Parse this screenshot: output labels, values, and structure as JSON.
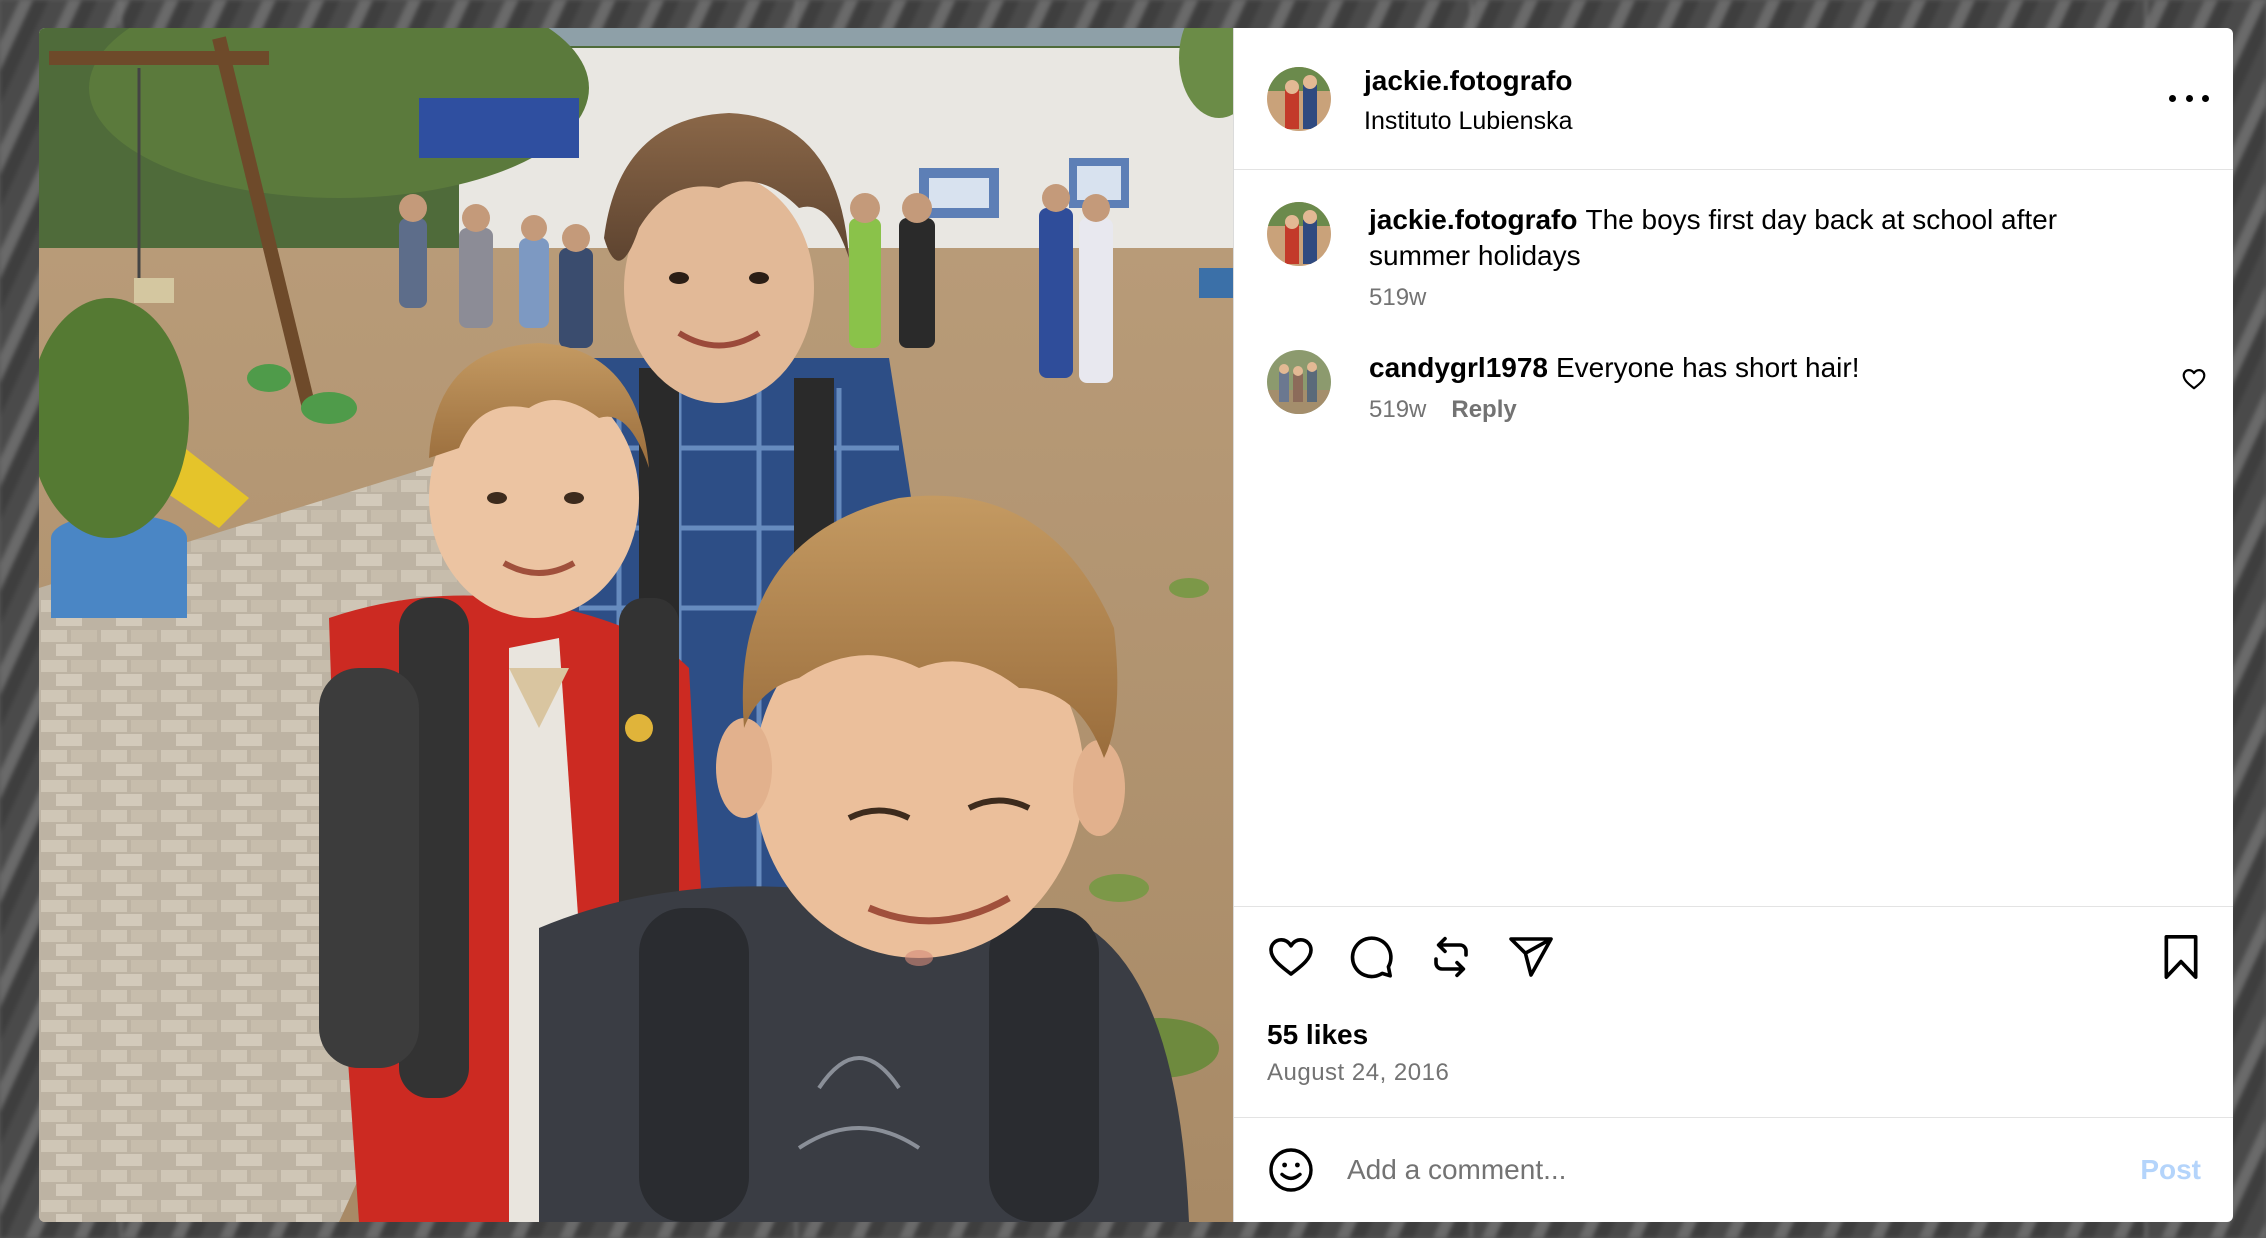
{
  "post": {
    "username": "jackie.fotografo",
    "location": "Instituto Lubienska",
    "photo_alt": "Three boys with backpacks smiling in a schoolyard"
  },
  "comments": [
    {
      "username": "jackie.fotografo",
      "text": "The boys first day back at school after summer holidays",
      "age": "519w"
    },
    {
      "username": "candygrl1978",
      "text": "Everyone has short hair!",
      "age": "519w",
      "reply_label": "Reply"
    }
  ],
  "stats": {
    "likes": "55 likes",
    "date": "August 24, 2016"
  },
  "composer": {
    "placeholder": "Add a comment...",
    "post_label": "Post"
  },
  "icons": {
    "like": "heart-icon",
    "comment": "comment-bubble-icon",
    "repost": "repost-icon",
    "share": "paper-plane-icon",
    "save": "bookmark-icon",
    "emoji": "emoji-icon",
    "more": "more-options-icon"
  },
  "colors": {
    "post_button_disabled": "#b4d4fb",
    "secondary_text": "#737373",
    "divider": "#e3e3e3"
  }
}
